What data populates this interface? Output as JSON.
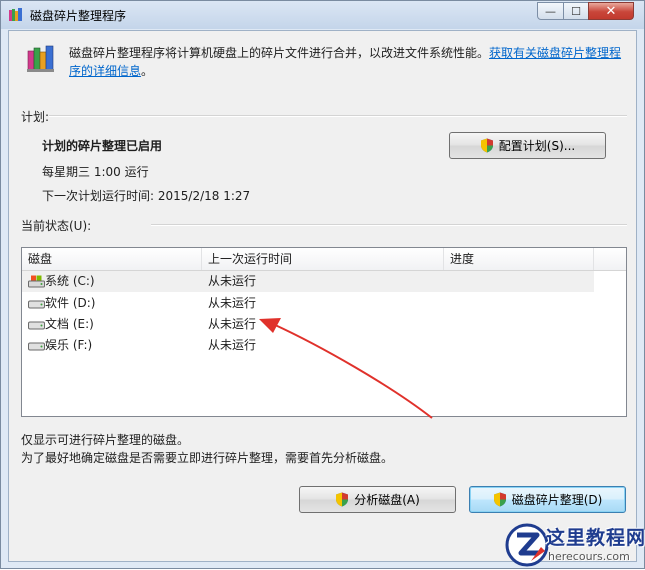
{
  "window": {
    "title": "磁盘碎片整理程序",
    "controls": {
      "minimize": "—",
      "maximize": "☐",
      "close": "✕"
    }
  },
  "intro": {
    "text": "磁盘碎片整理程序将计算机硬盘上的碎片文件进行合并，以改进文件系统性能。",
    "link": "获取有关磁盘碎片整理程序的详细信息",
    "suffix": "。"
  },
  "schedule": {
    "section_label": "计划:",
    "status": "计划的碎片整理已启用",
    "frequency": "每星期三  1:00 运行",
    "next_run": "下一次计划运行时间: 2015/2/18 1:27",
    "configure_button": "配置计划(S)..."
  },
  "current_status": {
    "section_label": "当前状态(U):",
    "columns": [
      "磁盘",
      "上一次运行时间",
      "进度"
    ],
    "rows": [
      {
        "disk": "系统 (C:)",
        "last_run": "从未运行",
        "progress": "",
        "icon": "system-drive-icon",
        "selected": true
      },
      {
        "disk": "软件 (D:)",
        "last_run": "从未运行",
        "progress": "",
        "icon": "drive-icon",
        "selected": false
      },
      {
        "disk": "文档 (E:)",
        "last_run": "从未运行",
        "progress": "",
        "icon": "drive-icon",
        "selected": false
      },
      {
        "disk": "娱乐 (F:)",
        "last_run": "从未运行",
        "progress": "",
        "icon": "drive-icon",
        "selected": false
      }
    ]
  },
  "footer": {
    "line1": "仅显示可进行碎片整理的磁盘。",
    "line2": "为了最好地确定磁盘是否需要立即进行碎片整理，需要首先分析磁盘。"
  },
  "actions": {
    "analyze": "分析磁盘(A)",
    "defragment": "磁盘碎片整理(D)"
  },
  "annotation": {
    "color": "#e0312b"
  },
  "watermark": {
    "title": "这里教程网",
    "url": "herecours.com"
  }
}
